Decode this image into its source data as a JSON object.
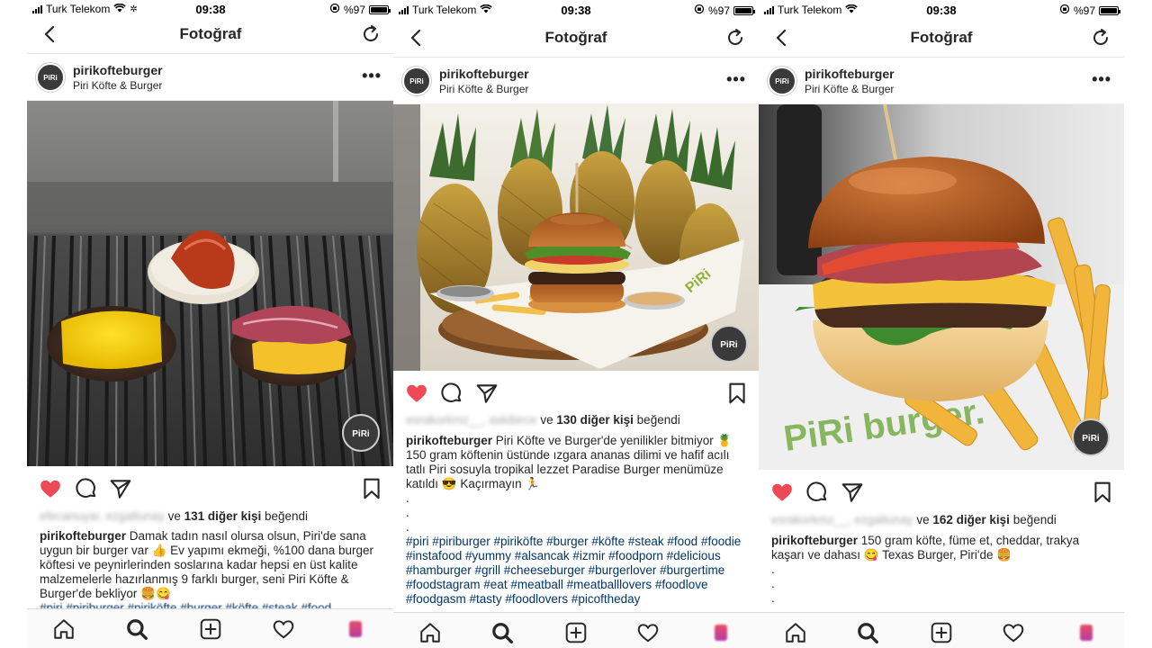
{
  "status_bar": {
    "carrier": "Turk Telekom",
    "time": "09:38",
    "battery": "%97"
  },
  "navbar": {
    "title": "Fotoğraf"
  },
  "posts": [
    {
      "username": "pirikofteburger",
      "location": "Piri Köfte & Burger",
      "avatar_text": "PiRi",
      "liked_by": "efecanuyar, ezgaltunay",
      "likes_connector": "ve",
      "likes_count": "131 diğer kişi",
      "likes_suffix": "beğendi",
      "caption_user": "pirikofteburger",
      "caption_text": "Damak tadın nasıl olursa olsun, Piri'de sana uygun bir burger var 👍 Ev yapımı ekmeği, %100 dana burger köftesi ve peynirlerinden soslarına kadar hepsi en üst kalite malzemelerle hazırlanmış 9 farklı burger, seni Piri Köfte & Burger'de bekliyor 🍔😋",
      "caption_tags": "#piri #piriburger #piriköfte #burger #köfte #steak #food"
    },
    {
      "username": "pirikofteburger",
      "location": "Piri Köfte & Burger",
      "avatar_text": "PiRi",
      "liked_by": "esrakorkmz__, askibirce",
      "likes_connector": "ve",
      "likes_count": "130 diğer kişi",
      "likes_suffix": "beğendi",
      "caption_user": "pirikofteburger",
      "caption_text": "Piri Köfte ve Burger'de yenilikler bitmiyor 🍍 150 gram köftenin üstünde ızgara ananas dilimi ve hafif acılı tatlı Piri sosuyla tropikal lezzet Paradise Burger menümüze katıldı 😎 Kaçırmayın 🏃",
      "caption_tags": "#piri #piriburger #piriköfte #burger #köfte #steak #food #foodie #instafood #yummy #alsancak #izmir #foodporn #delicious #hamburger #grill #cheeseburger #burgerlover #burgertime #foodstagram #eat #meatball #meatballlovers #foodlove #foodgasm #tasty #foodlovers #picoftheday"
    },
    {
      "username": "pirikofteburger",
      "location": "Piri Köfte & Burger",
      "avatar_text": "PiRi",
      "liked_by": "esrakorkmz__, ezgaltunay",
      "likes_connector": "ve",
      "likes_count": "162 diğer kişi",
      "likes_suffix": "beğendi",
      "caption_user": "pirikofteburger",
      "caption_text": "150 gram köfte, füme et, cheddar, trakya kaşarı ve dahası 😋 Texas Burger, Piri'de 🍔",
      "caption_tags": ""
    }
  ],
  "watermark": "PiRi",
  "photo_text": {
    "wrap_brand": "PiRi",
    "paper_brand": "PiRi burger."
  },
  "colors": {
    "heart": "#ed4956",
    "tag": "#003569",
    "text": "#262626"
  },
  "icons": [
    "back-icon",
    "refresh-icon",
    "more-icon",
    "heart-icon",
    "comment-icon",
    "share-icon",
    "bookmark-icon",
    "home-icon",
    "search-icon",
    "add-icon",
    "activity-icon",
    "profile-icon"
  ]
}
